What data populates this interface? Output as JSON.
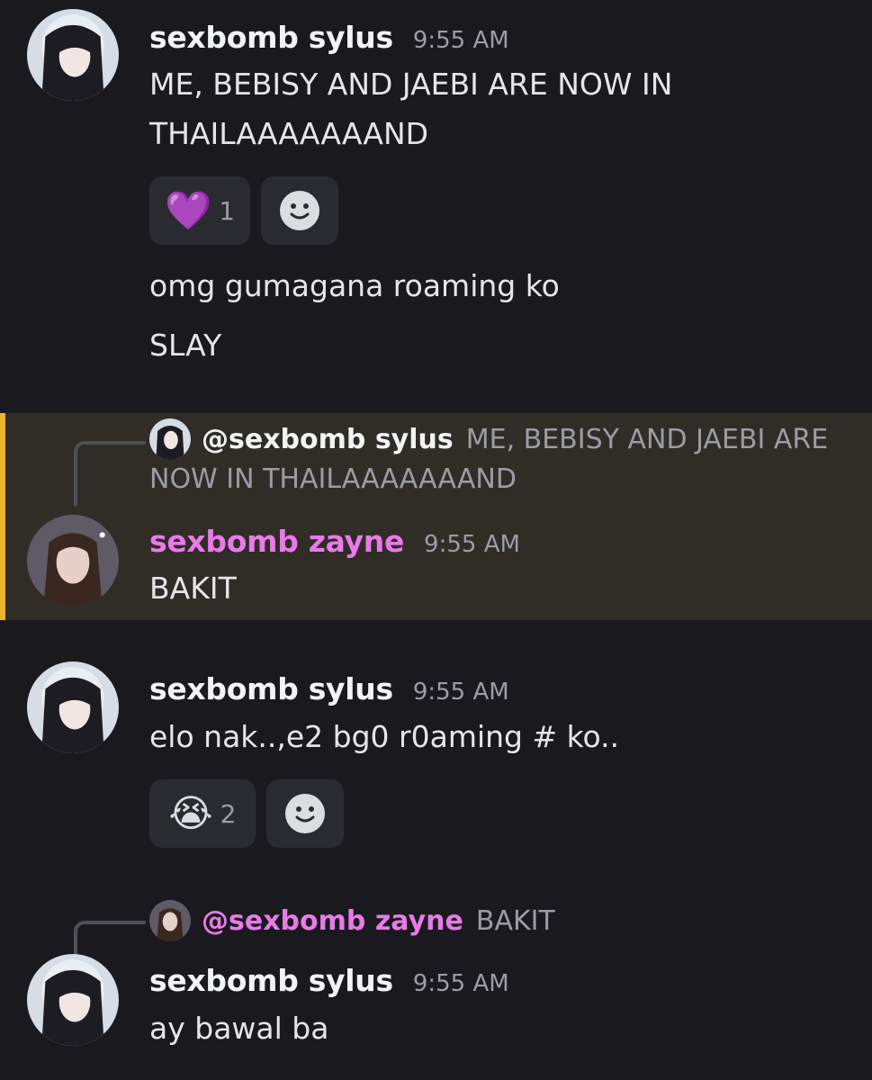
{
  "users": {
    "sylus": {
      "name": "sexbomb sylus",
      "mention": "@sexbomb sylus"
    },
    "zayne": {
      "name": "sexbomb zayne",
      "mention": "@sexbomb zayne"
    }
  },
  "messages": [
    {
      "author": "sexbomb sylus",
      "time": "9:55 AM",
      "lines": [
        "ME, BEBISY AND JAEBI ARE NOW IN",
        "THAILAAAAAAAND"
      ],
      "reactions": [
        {
          "emoji": "💜",
          "count": "1"
        }
      ],
      "extra": [
        "omg gumagana roaming ko",
        "SLAY"
      ]
    },
    {
      "reply_to": "@sexbomb sylus",
      "reply_text_1": "ME, BEBISY AND JAEBI ARE",
      "reply_text_2": "NOW IN THAILAAAAAAAND",
      "author": "sexbomb zayne",
      "time": "9:55 AM",
      "text": "BAKIT"
    },
    {
      "author": "sexbomb sylus",
      "time": "9:55 AM",
      "text": "elo nak..,e2 bg0 r0aming # ko..",
      "reactions": [
        {
          "emoji": "😭",
          "count": "2"
        }
      ]
    },
    {
      "reply_to": "@sexbomb zayne",
      "reply_text": "BAKIT",
      "author": "sexbomb sylus",
      "time": "9:55 AM",
      "text": "ay bawal ba"
    }
  ],
  "icons": {
    "add_reaction": "smiley-face-icon"
  }
}
